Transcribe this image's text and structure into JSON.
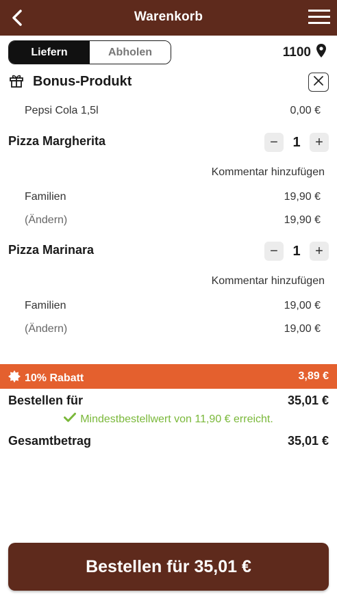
{
  "header": {
    "title": "Warenkorb"
  },
  "delivery_toggle": {
    "options": [
      "Liefern",
      "Abholen"
    ],
    "selected": "Liefern"
  },
  "location": {
    "plz": "1100"
  },
  "bonus": {
    "title": "Bonus-Produkt",
    "item_name": "Pepsi Cola 1,5l",
    "item_price": "0,00 €"
  },
  "items": [
    {
      "name": "Pizza Margherita",
      "quantity": "1",
      "comment_label": "Kommentar hinzufügen",
      "size": "Familien",
      "size_price": "19,90 €",
      "change_label": "(Ändern)",
      "total": "19,90 €"
    },
    {
      "name": "Pizza Marinara",
      "quantity": "1",
      "comment_label": "Kommentar hinzufügen",
      "size": "Familien",
      "size_price": "19,00 €",
      "change_label": "(Ändern)",
      "total": "19,00 €"
    }
  ],
  "discount": {
    "label": "10% Rabatt",
    "value": "3,89 €",
    "color": "#e4602e"
  },
  "summary": {
    "order_for_label": "Bestellen für",
    "order_for_value": "35,01 €",
    "min_order_note": "Mindestbestellwert von 11,90 € erreicht.",
    "total_label": "Gesamtbetrag",
    "total_value": "35,01 €"
  },
  "order_button": {
    "label": "Bestellen für 35,01 €"
  },
  "colors": {
    "brand": "#5e2a1c",
    "accent": "#e4602e",
    "success": "#7ab83a"
  }
}
